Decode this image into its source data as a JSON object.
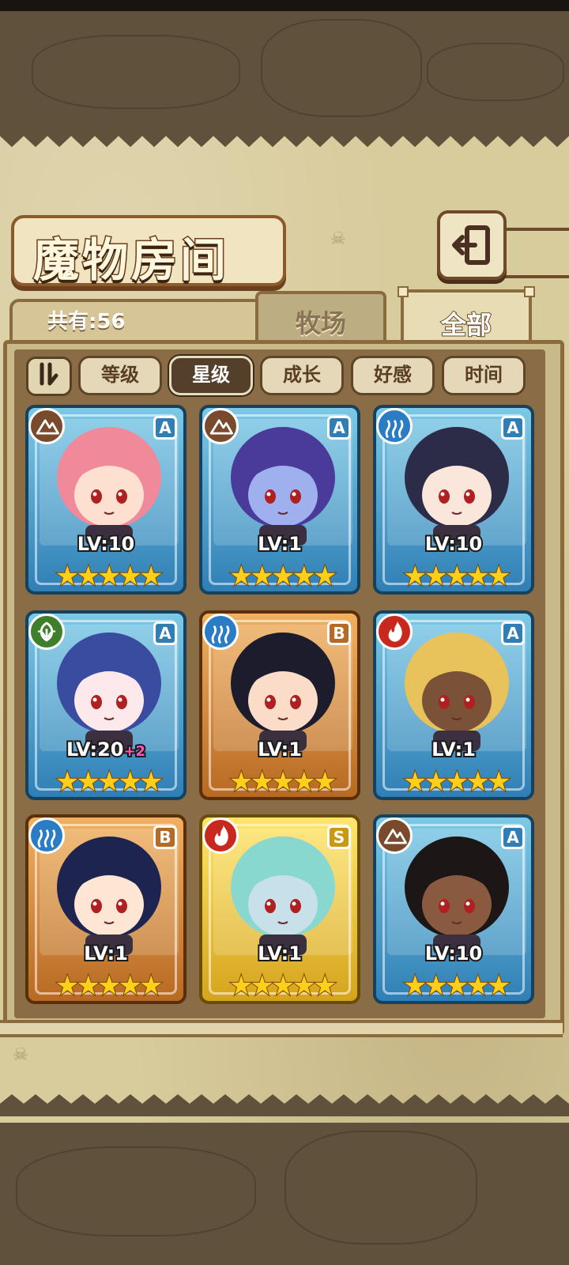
{
  "header": {
    "title": "魔物房间"
  },
  "tabs": {
    "count_label": "共有:56",
    "pasture_label": "牧场",
    "all_label": "全部",
    "selected": "全部"
  },
  "sort": {
    "buttons": [
      {
        "label": "等级",
        "active": false
      },
      {
        "label": "星级",
        "active": true
      },
      {
        "label": "成长",
        "active": false
      },
      {
        "label": "好感",
        "active": false
      },
      {
        "label": "时间",
        "active": false
      }
    ]
  },
  "monsters": [
    {
      "level": "LV:10",
      "level_bonus": "",
      "rank": "A",
      "element": "earth",
      "stars": 5,
      "frame": "blue",
      "hair_color": "#f08a9a",
      "skin_color": "#fde0d0"
    },
    {
      "level": "LV:1",
      "level_bonus": "",
      "rank": "A",
      "element": "earth",
      "stars": 5,
      "frame": "blue",
      "hair_color": "#4a3a9a",
      "skin_color": "#9eb0ee"
    },
    {
      "level": "LV:10",
      "level_bonus": "",
      "rank": "A",
      "element": "water",
      "stars": 5,
      "frame": "blue",
      "hair_color": "#2c2c48",
      "skin_color": "#fbe6dc"
    },
    {
      "level": "LV:20",
      "level_bonus": "+2",
      "rank": "A",
      "element": "wood",
      "stars": 5,
      "frame": "blue",
      "hair_color": "#3a4ca0",
      "skin_color": "#fde8ec"
    },
    {
      "level": "LV:1",
      "level_bonus": "",
      "rank": "B",
      "element": "water",
      "stars": 5,
      "frame": "orange",
      "hair_color": "#1c1c2c",
      "skin_color": "#fbdcc8"
    },
    {
      "level": "LV:1",
      "level_bonus": "",
      "rank": "A",
      "element": "fire",
      "stars": 5,
      "frame": "blue",
      "hair_color": "#e8c25a",
      "skin_color": "#7a5238"
    },
    {
      "level": "LV:1",
      "level_bonus": "",
      "rank": "B",
      "element": "water",
      "stars": 5,
      "frame": "orange",
      "hair_color": "#1e2450",
      "skin_color": "#fde6d4"
    },
    {
      "level": "LV:1",
      "level_bonus": "",
      "rank": "S",
      "element": "fire",
      "stars": 5,
      "frame": "gold",
      "hair_color": "#88d8d0",
      "skin_color": "#c8e0ea"
    },
    {
      "level": "LV:10",
      "level_bonus": "",
      "rank": "A",
      "element": "earth",
      "stars": 5,
      "frame": "blue",
      "hair_color": "#1c1616",
      "skin_color": "#8a5a40"
    }
  ],
  "icons": {
    "back": "back-arrow-icon",
    "sort_toggle": "sort-toggle-icon",
    "earth": "mountain-icon",
    "water": "wave-icon",
    "wood": "leaf-icon",
    "fire": "flame-icon",
    "star": "star-icon"
  },
  "colors": {
    "parchment": "#d8cb9c",
    "panel": "#8a6c46",
    "frame_blue": "#2f7fb6",
    "frame_orange": "#b86a22",
    "frame_gold": "#d5a41c",
    "star": "#ffcf1a"
  }
}
